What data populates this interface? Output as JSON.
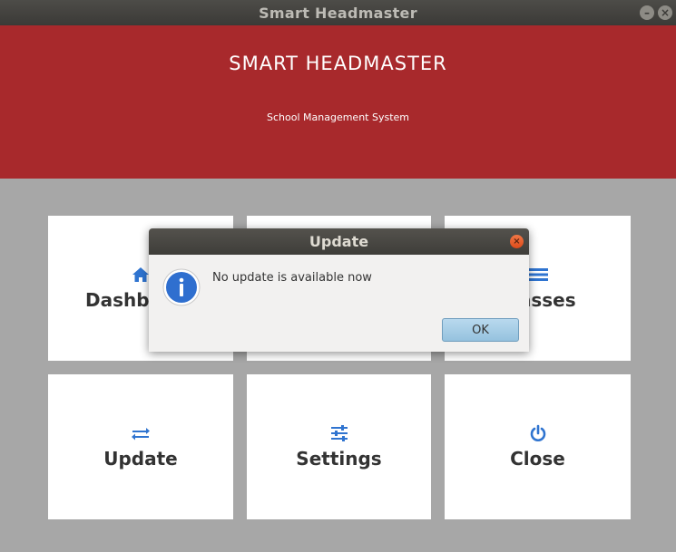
{
  "window": {
    "title": "Smart Headmaster",
    "min_glyph": "–",
    "close_glyph": "×"
  },
  "header": {
    "title": "SMART HEADMASTER",
    "subtitle": "School Management System",
    "bg_color": "#a8292c"
  },
  "tiles": [
    {
      "label": "Dashboard",
      "icon": "home-icon"
    },
    {
      "label": "",
      "icon": ""
    },
    {
      "label": "Classes",
      "icon": "list-icon"
    },
    {
      "label": "Update",
      "icon": "swap-arrows-icon"
    },
    {
      "label": "Settings",
      "icon": "sliders-icon"
    },
    {
      "label": "Close",
      "icon": "power-icon"
    }
  ],
  "dialog": {
    "title": "Update",
    "message": "No update is available now",
    "ok_label": "OK",
    "close_glyph": "×",
    "icon": "info-icon"
  },
  "colors": {
    "accent_icon": "#2f74d0",
    "background": "#a7a7a7"
  }
}
